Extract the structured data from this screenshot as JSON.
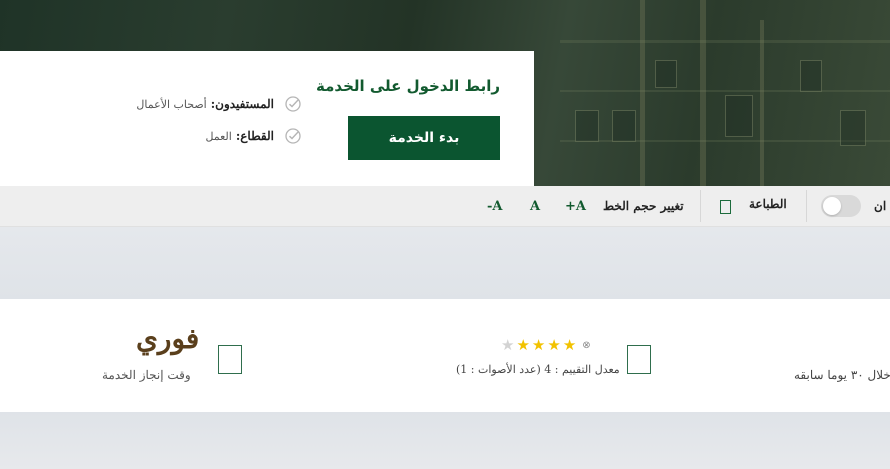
{
  "service_card": {
    "login_title": "رابط الدخول على الخدمة",
    "start_button": "بدء الخدمة",
    "beneficiaries_label": "المستفيدون:",
    "beneficiaries_value": "أصحاب الأعمال",
    "sector_label": "القطاع:",
    "sector_value": "العمل"
  },
  "toolbar": {
    "toggle_label_partial": "ان",
    "print_label": "الطباعة",
    "font_size_label": "تغيير حجم الخط",
    "font_increase": "A+",
    "font_normal": "A",
    "font_decrease": "A-"
  },
  "stats": {
    "speed_value": "فوري",
    "speed_label": "وقت إنجاز الخدمة",
    "rating_text": "معدل التقييم : 4 (عدد الأصوات : 1)",
    "rating": 4,
    "rating_max": 5,
    "period_text_partial": "خلال ٣٠ يوما سابقه"
  },
  "colors": {
    "primary_green": "#0b5530",
    "title_green": "#125a2f",
    "star_on": "#f2c200",
    "speed_brown": "#5a3f1c"
  },
  "icons": [
    "check-circle-icon",
    "print-icon",
    "clock-icon",
    "rating-icon",
    "reset-icon",
    "star-icon"
  ]
}
